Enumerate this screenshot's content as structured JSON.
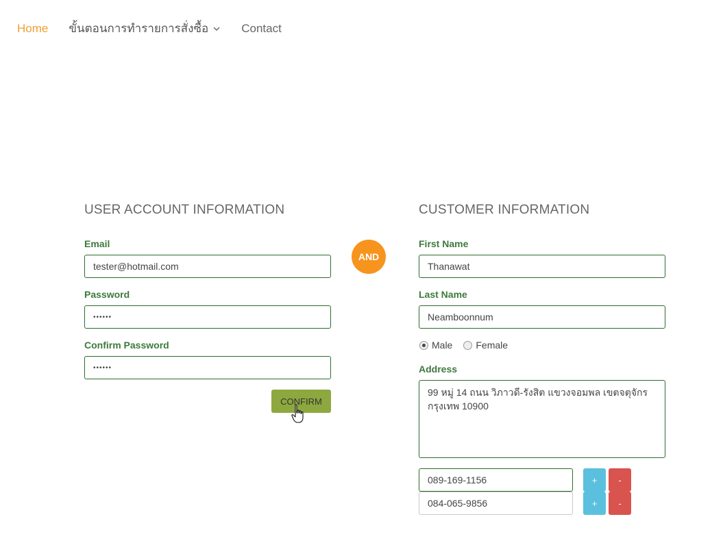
{
  "nav": {
    "home": "Home",
    "order_steps": "ขั้นตอนการทำรายการสั่งซื้อ",
    "contact": "Contact"
  },
  "user_account": {
    "title": "USER ACCOUNT INFORMATION",
    "email_label": "Email",
    "email_value": "tester@hotmail.com",
    "password_label": "Password",
    "password_value": "••••••",
    "confirm_password_label": "Confirm Password",
    "confirm_password_value": "••••••",
    "confirm_button": "CONFIRM"
  },
  "and_badge": "AND",
  "customer": {
    "title": "CUSTOMER INFORMATION",
    "first_name_label": "First Name",
    "first_name_value": "Thanawat",
    "last_name_label": "Last Name",
    "last_name_value": "Neamboonnum",
    "gender_male": "Male",
    "gender_female": "Female",
    "gender_selected": "Male",
    "address_label": "Address",
    "address_line1": "99 หมู่ 14 ถนน วิภาวดี-รังสิต แขวงจอมพล เขตจตุจักร",
    "address_line2": "กรุงเทพ 10900",
    "phones": [
      "089-169-1156",
      "084-065-9856"
    ],
    "plus_label": "+",
    "minus_label": "-"
  },
  "colors": {
    "accent_orange": "#f7941d",
    "nav_active": "#f0a030",
    "label_green": "#3c7a3c",
    "confirm_green": "#8da83e",
    "plus_blue": "#5bc0de",
    "minus_red": "#d9534f"
  }
}
